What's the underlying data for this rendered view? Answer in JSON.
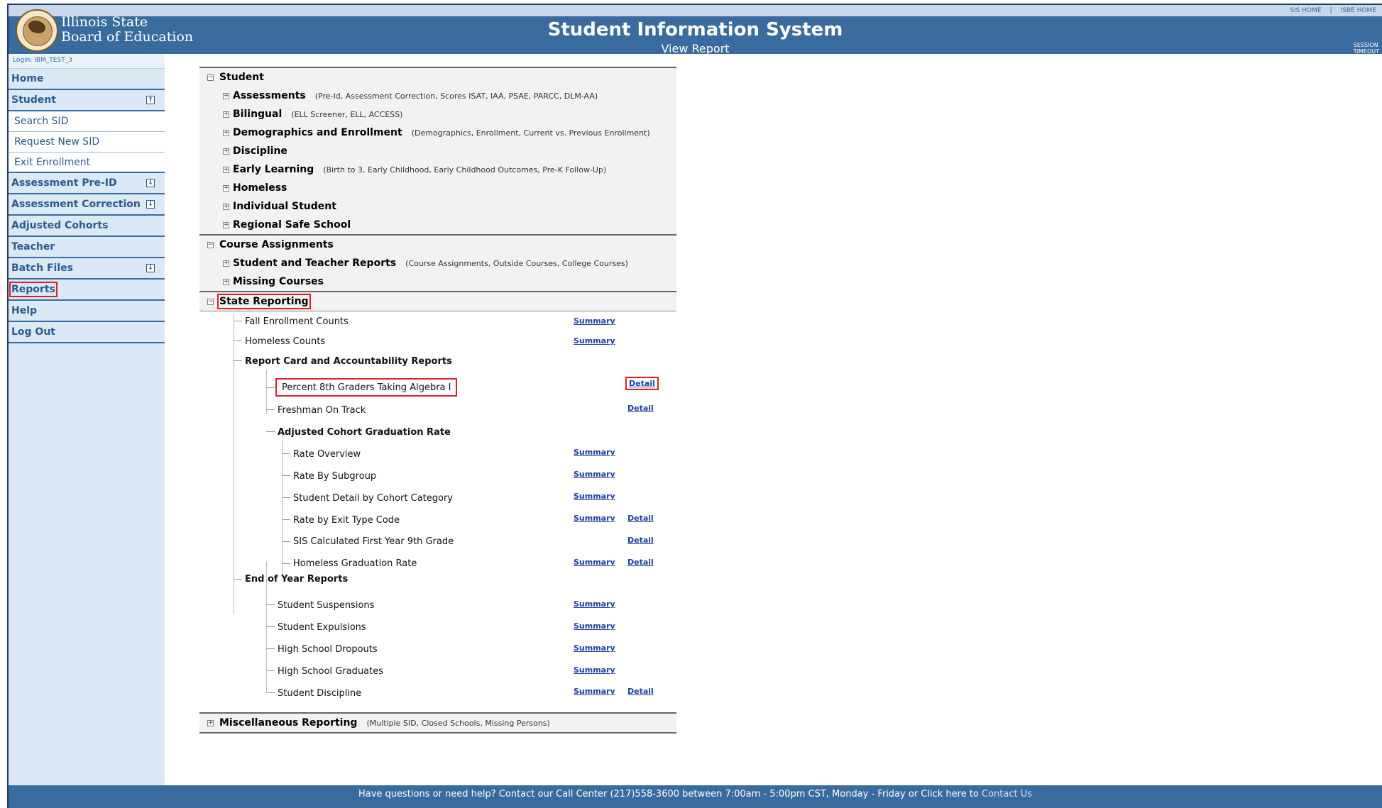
{
  "header": {
    "org_line1": "Illinois State",
    "org_line2": "Board of Education",
    "title": "Student Information System",
    "subtitle": "View Report",
    "top_links": [
      "SIS HOME",
      "|",
      "ISBE HOME"
    ],
    "session_line1": "SESSION",
    "session_line2": "TIMEOUT"
  },
  "sidebar": {
    "login": "Login: IBM_TEST_3",
    "items": [
      {
        "label": "Home"
      },
      {
        "label": "Student",
        "toggle": "⇑"
      },
      {
        "label": "Search SID"
      },
      {
        "label": "Request New SID"
      },
      {
        "label": "Exit Enrollment"
      },
      {
        "label": "Assessment Pre-ID",
        "toggle": "⇓"
      },
      {
        "label": "Assessment Correction",
        "toggle": "⇓"
      },
      {
        "label": "Adjusted Cohorts"
      },
      {
        "label": "Teacher"
      },
      {
        "label": "Batch Files",
        "toggle": "⇓"
      },
      {
        "label": "Reports"
      },
      {
        "label": "Help"
      },
      {
        "label": "Log Out"
      }
    ]
  },
  "tree": {
    "student": {
      "title": "Student",
      "items": [
        {
          "label": "Assessments",
          "note": "(Pre-Id, Assessment Correction, Scores ISAT, IAA, PSAE, PARCC, DLM-AA)"
        },
        {
          "label": "Bilingual",
          "note": "(ELL Screener, ELL, ACCESS)"
        },
        {
          "label": "Demographics and Enrollment",
          "note": "(Demographics, Enrollment, Current vs. Previous Enrollment)"
        },
        {
          "label": "Discipline",
          "note": ""
        },
        {
          "label": "Early Learning",
          "note": "(Birth to 3, Early Childhood, Early Childhood Outcomes, Pre-K Follow-Up)"
        },
        {
          "label": "Homeless",
          "note": ""
        },
        {
          "label": "Individual Student",
          "note": ""
        },
        {
          "label": "Regional Safe School",
          "note": ""
        }
      ]
    },
    "course": {
      "title": "Course Assignments",
      "items": [
        {
          "label": "Student and Teacher Reports",
          "note": "(Course Assignments, Outside Courses, College Courses)"
        },
        {
          "label": "Missing Courses",
          "note": ""
        }
      ]
    },
    "state": {
      "title": "State Reporting",
      "fall": "Fall Enrollment Counts",
      "homeless_counts": "Homeless Counts",
      "report_card": "Report Card and Accountability Reports",
      "pct8": "Percent 8th Graders Taking Algebra I",
      "freshman": "Freshman On Track",
      "acgr": "Adjusted Cohort Graduation Rate",
      "rate_overview": "Rate Overview",
      "rate_subgroup": "Rate By Subgroup",
      "student_detail_cohort": "Student Detail by Cohort Category",
      "rate_exit": "Rate by Exit Type Code",
      "sis_first_year": "SIS Calculated First Year 9th Grade",
      "homeless_grad": "Homeless Graduation Rate",
      "eoy": "End of Year Reports",
      "suspensions": "Student Suspensions",
      "expulsions": "Student Expulsions",
      "dropouts": "High School Dropouts",
      "graduates": "High School Graduates",
      "discipline": "Student Discipline"
    },
    "misc": {
      "title": "Miscellaneous Reporting",
      "note": "(Multiple SID, Closed Schools, Missing Persons)"
    },
    "links": {
      "summary": "Summary",
      "detail": "Detail"
    },
    "expand": "+",
    "collapse": "−"
  },
  "footer": {
    "text": "Have questions or need help? Contact our Call Center (217)558-3600 between 7:00am - 5:00pm CST, Monday - Friday or Click here to",
    "contact": "Contact Us"
  }
}
